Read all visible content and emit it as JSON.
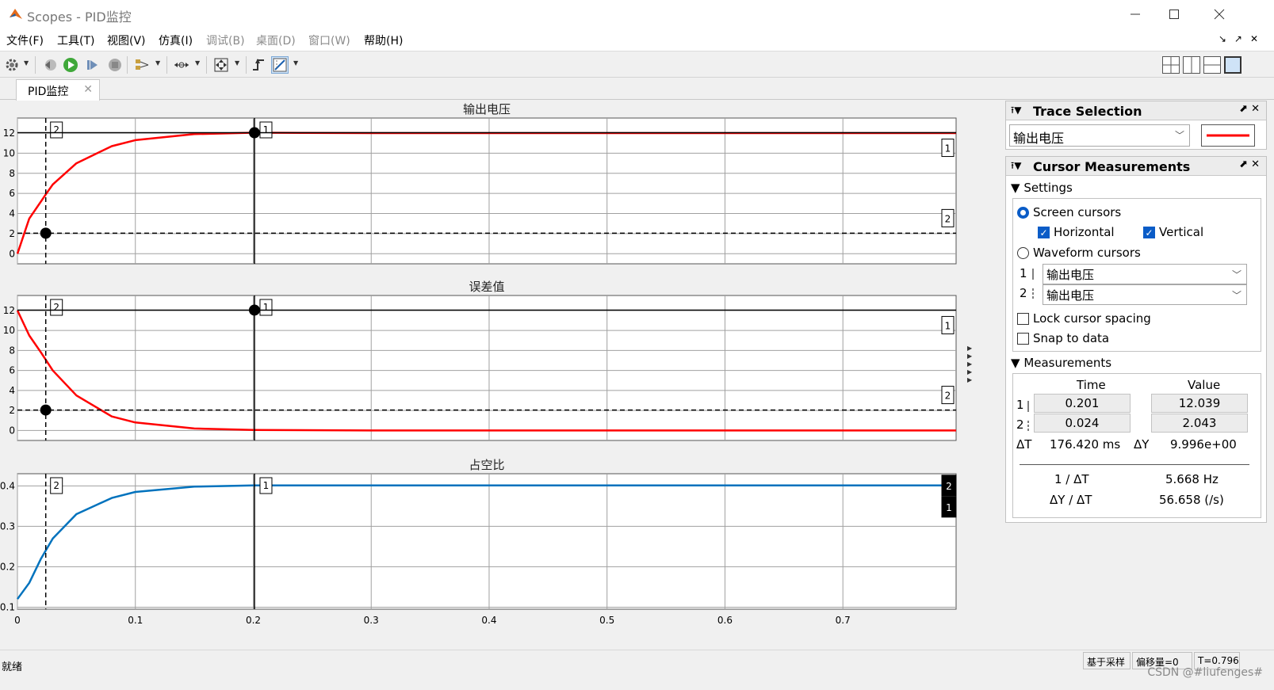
{
  "window": {
    "title": "Scopes - PID监控",
    "minimize_icon": "minimize-icon",
    "maximize_icon": "maximize-icon",
    "close_icon": "close-icon"
  },
  "menu": [
    "文件(F)",
    "工具(T)",
    "视图(V)",
    "仿真(I)",
    "调试(B)",
    "桌面(D)",
    "窗口(W)",
    "帮助(H)"
  ],
  "menu_disabled": [
    "调试(B)",
    "桌面(D)",
    "窗口(W)"
  ],
  "toolbar_icons": [
    "gear-icon",
    "step-back-icon",
    "run-icon",
    "step-forward-icon",
    "stop-icon",
    "signal-highlight-icon",
    "zoom-icon",
    "autoscale-icon",
    "trigger-icon",
    "cursor-measurement-icon"
  ],
  "tab": {
    "label": "PID监控"
  },
  "plots": [
    {
      "title": "输出电压",
      "color": "#ff0000",
      "y_ticks": [
        "12",
        "10",
        "8",
        "6",
        "4",
        "2",
        "0"
      ]
    },
    {
      "title": "误差值",
      "color": "#ff0000",
      "y_ticks": [
        "12",
        "10",
        "8",
        "6",
        "4",
        "2",
        "0"
      ]
    },
    {
      "title": "占空比",
      "color": "#0072bd",
      "y_ticks": [
        "0.4",
        "0.3",
        "0.2",
        "0.1"
      ]
    }
  ],
  "x_ticks": [
    "0",
    "0.1",
    "0.2",
    "0.3",
    "0.4",
    "0.5",
    "0.6",
    "0.7"
  ],
  "cursor_labels": {
    "c1": "1",
    "c2": "2"
  },
  "chart_data": [
    {
      "type": "line",
      "title": "输出电压",
      "x": [
        0,
        0.01,
        0.02,
        0.024,
        0.03,
        0.05,
        0.08,
        0.1,
        0.15,
        0.2,
        0.3,
        0.5,
        0.796
      ],
      "y": [
        0,
        3.5,
        5.2,
        5.9,
        6.9,
        9.0,
        10.7,
        11.3,
        11.9,
        12.04,
        12.0,
        12.0,
        12.0
      ],
      "xlim": [
        0,
        0.796
      ],
      "ylim": [
        -1,
        13.5
      ],
      "cursor_v": [
        0.201,
        0.024
      ],
      "cursor_h": [
        12.039,
        2.043
      ]
    },
    {
      "type": "line",
      "title": "误差值",
      "x": [
        0,
        0.01,
        0.02,
        0.03,
        0.05,
        0.08,
        0.1,
        0.15,
        0.2,
        0.3,
        0.5,
        0.796
      ],
      "y": [
        12,
        9.5,
        7.8,
        6.0,
        3.5,
        1.4,
        0.8,
        0.2,
        0.05,
        0,
        0,
        0
      ],
      "xlim": [
        0,
        0.796
      ],
      "ylim": [
        -1,
        13.5
      ],
      "cursor_v": [
        0.201,
        0.024
      ],
      "cursor_h": [
        12.039,
        2.043
      ]
    },
    {
      "type": "line",
      "title": "占空比",
      "x": [
        0,
        0.01,
        0.02,
        0.03,
        0.05,
        0.08,
        0.1,
        0.15,
        0.2,
        0.3,
        0.5,
        0.796
      ],
      "y": [
        0.12,
        0.16,
        0.22,
        0.27,
        0.33,
        0.37,
        0.385,
        0.398,
        0.401,
        0.401,
        0.401,
        0.401
      ],
      "xlim": [
        0,
        0.796
      ],
      "ylim": [
        0.095,
        0.43
      ],
      "cursor_v": [
        0.201,
        0.024
      ]
    }
  ],
  "trace_selection": {
    "title": "Trace Selection",
    "selected": "输出电压",
    "line_color": "#ff0000"
  },
  "cursor_measurements": {
    "title": "Cursor Measurements",
    "settings_label": "Settings",
    "screen_cursors": "Screen cursors",
    "horizontal": "Horizontal",
    "vertical": "Vertical",
    "waveform_cursors": "Waveform cursors",
    "wf1_index": "1",
    "wf2_index": "2",
    "wf1_value": "输出电压",
    "wf2_value": "输出电压",
    "lock_spacing": "Lock cursor spacing",
    "snap": "Snap to data",
    "measurements_label": "Measurements",
    "col_time": "Time",
    "col_value": "Value",
    "row1_index": "1",
    "row2_index": "2",
    "row1_time": "0.201",
    "row2_time": "0.024",
    "row1_value": "12.039",
    "row2_value": "2.043",
    "dt_label": "ΔT",
    "dt_value": "176.420 ms",
    "dy_label": "ΔY",
    "dy_value": "9.996e+00",
    "inv_dt_label": "1 / ΔT",
    "inv_dt_value": "5.668 Hz",
    "slope_label": "ΔY / ΔT",
    "slope_value": "56.658 (/s)"
  },
  "status": {
    "left": "就绪",
    "sample": "基于采样",
    "offset": "偏移量=0",
    "time": "T=0.796"
  },
  "watermark": "CSDN @#liufenges#"
}
